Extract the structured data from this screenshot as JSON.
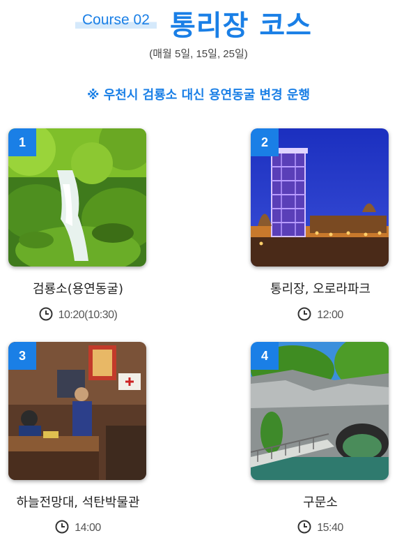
{
  "header": {
    "course_tag": "Course 02",
    "title": "통리장 코스",
    "subtitle": "(매월 5일, 15일, 25일)",
    "notice": "※ 우천시 검룡소 대신 용연동굴 변경 운행"
  },
  "stops": [
    {
      "number": "1",
      "name": "검룡소(용연동굴)",
      "time": "10:20(10:30)",
      "photo": "mossy-waterfall"
    },
    {
      "number": "2",
      "name": "통리장, 오로라파크",
      "time": "12:00",
      "photo": "lit-tower-at-night"
    },
    {
      "number": "3",
      "name": "하늘전망대, 석탄박물관",
      "time": "14:00",
      "photo": "mining-museum-diorama"
    },
    {
      "number": "4",
      "name": "구문소",
      "time": "15:40",
      "photo": "rock-arch-river"
    }
  ],
  "colors": {
    "accent": "#1a7fe6",
    "tag_highlight": "#d5e9fb"
  },
  "icons": {
    "time": "clock-icon"
  }
}
